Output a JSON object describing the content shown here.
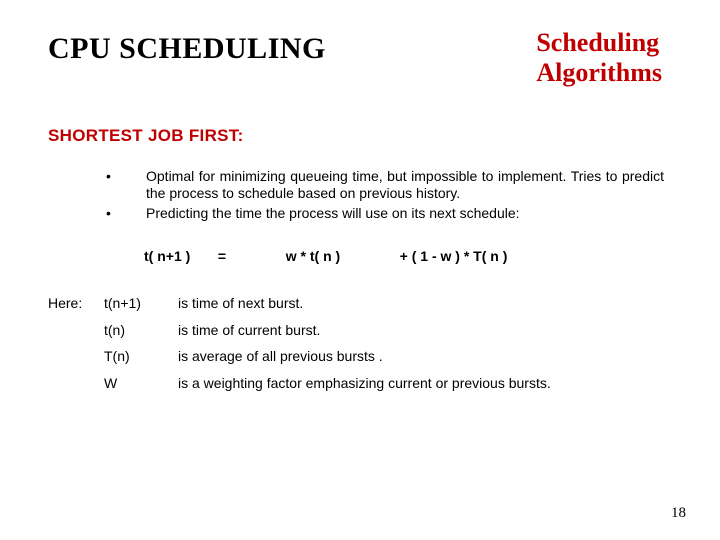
{
  "header": {
    "title": "CPU SCHEDULING",
    "subtitle_line1": "Scheduling",
    "subtitle_line2": "Algorithms"
  },
  "section_heading": "SHORTEST JOB FIRST:",
  "bullets": [
    "Optimal for minimizing queueing time, but impossible to implement. Tries to predict the process to schedule based on previous history.",
    "Predicting the time the process will use on its next schedule:"
  ],
  "formula": {
    "lhs": "t( n+1 )",
    "eq": "=",
    "term1": "w * t( n )",
    "term2": "+  ( 1 - w )  * T( n )"
  },
  "defs": {
    "label": "Here:",
    "rows": [
      {
        "sym": "t(n+1)",
        "text": "is time of next burst."
      },
      {
        "sym": "t(n)",
        "text": "is time of current burst."
      },
      {
        "sym": "T(n)",
        "text": "is average of all previous bursts ."
      },
      {
        "sym": "W",
        "text": "is a weighting factor emphasizing current or previous bursts."
      }
    ]
  },
  "page_number": "18"
}
